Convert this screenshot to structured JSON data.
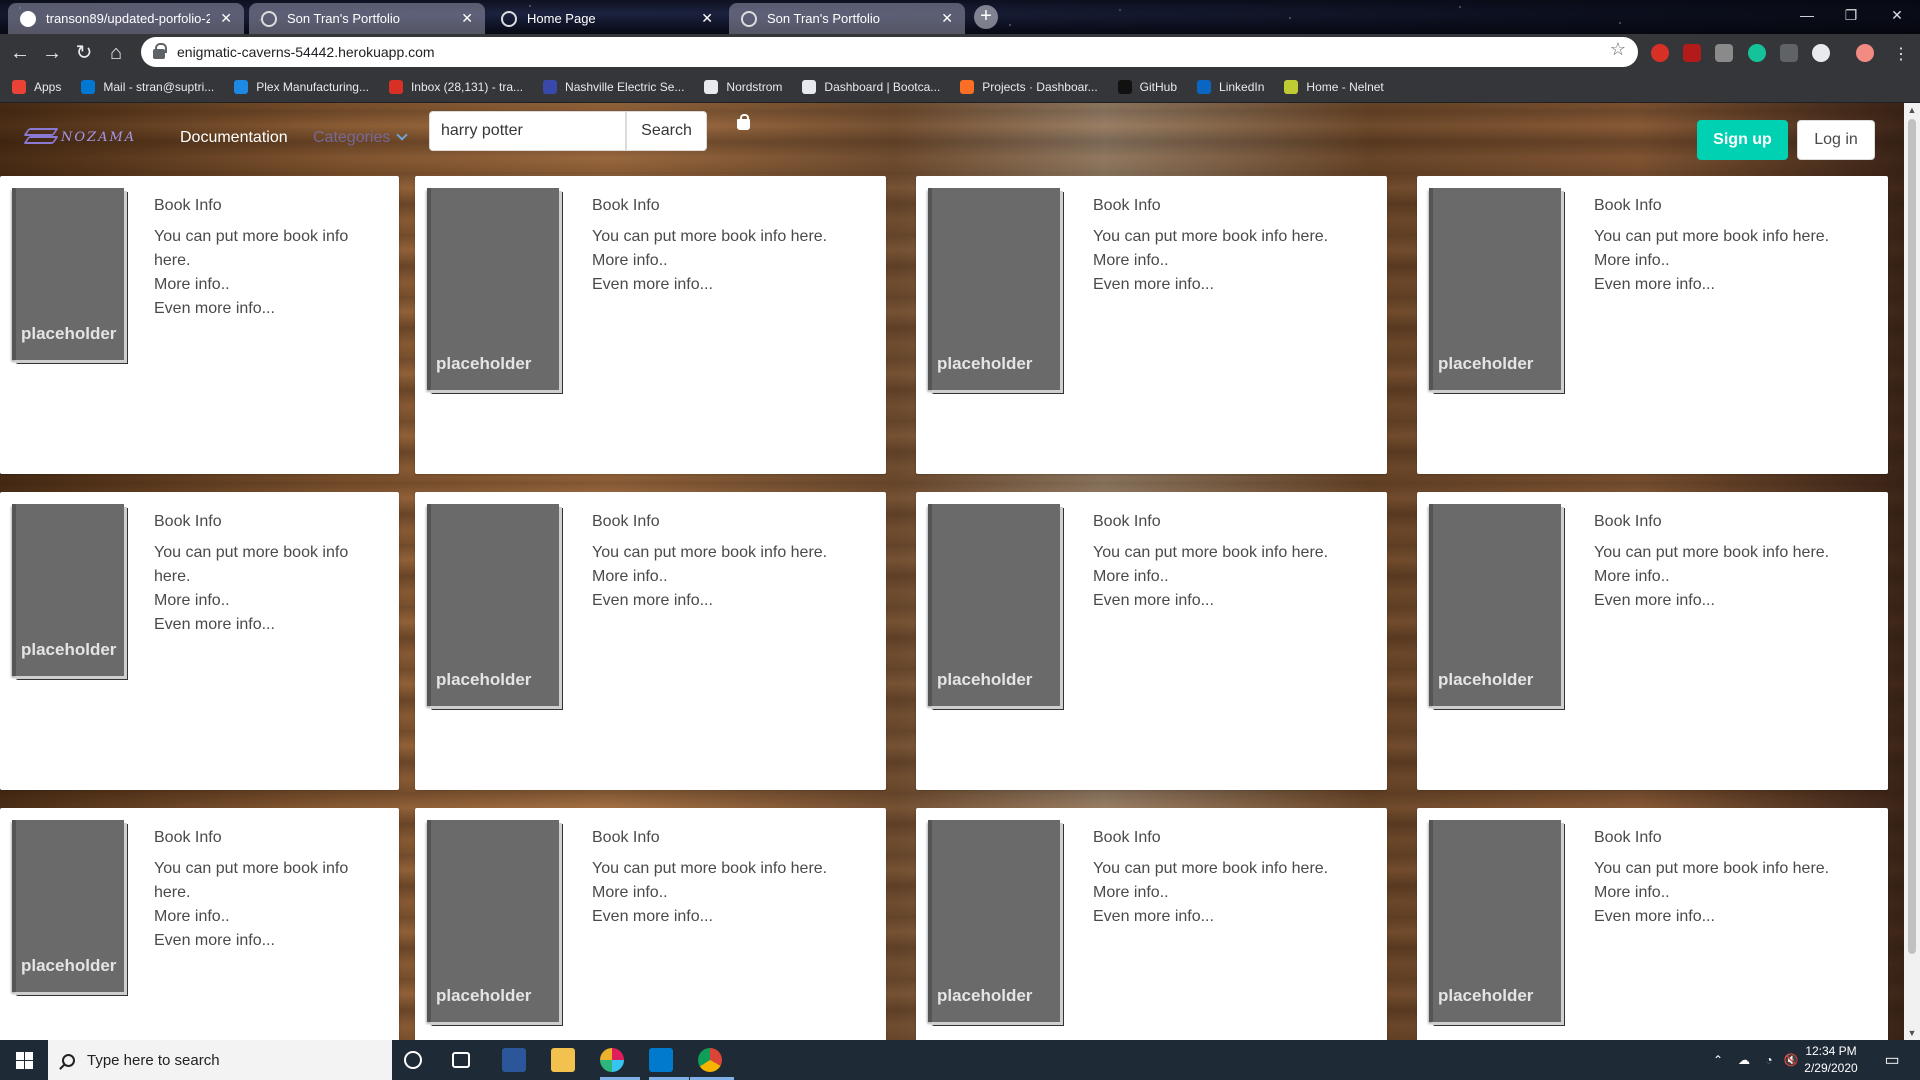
{
  "browser": {
    "tabs": [
      {
        "title": "transon89/updated-porfolio-2"
      },
      {
        "title": "Son Tran's Portfolio"
      },
      {
        "title": "Home Page"
      },
      {
        "title": "Son Tran's Portfolio"
      }
    ],
    "url": "enigmatic-caverns-54442.herokuapp.com",
    "bookmarks": [
      {
        "label": "Apps",
        "color": "#ea4335"
      },
      {
        "label": "Mail - stran@suptri...",
        "color": "#0078d4"
      },
      {
        "label": "Plex Manufacturing...",
        "color": "#1e88e5"
      },
      {
        "label": "Inbox (28,131) - tra...",
        "color": "#d93025"
      },
      {
        "label": "Nashville Electric Se...",
        "color": "#3949ab"
      },
      {
        "label": "Nordstrom",
        "color": "#e8eaed"
      },
      {
        "label": "Dashboard | Bootca...",
        "color": "#e8eaed"
      },
      {
        "label": "Projects · Dashboar...",
        "color": "#fc6d26"
      },
      {
        "label": "GitHub",
        "color": "#111111"
      },
      {
        "label": "LinkedIn",
        "color": "#0a66c2"
      },
      {
        "label": "Home - Nelnet",
        "color": "#c0ca33"
      }
    ]
  },
  "site": {
    "logo_text": "NOZAMA",
    "nav_documentation": "Documentation",
    "nav_categories": "Categories",
    "search_value": "harry potter",
    "search_button": "Search",
    "signup": "Sign up",
    "login": "Log in"
  },
  "cards": [
    {
      "image": "placeholder",
      "title": "Book Info",
      "lines": [
        "You can put more book info",
        "here.",
        "More info..",
        "Even more info..."
      ]
    },
    {
      "image": "placeholder",
      "title": "Book Info",
      "lines": [
        "You can put more book info here.",
        "More info..",
        "Even more info..."
      ]
    },
    {
      "image": "placeholder",
      "title": "Book Info",
      "lines": [
        "You can put more book info here.",
        "More info..",
        "Even more info..."
      ]
    },
    {
      "image": "placeholder",
      "title": "Book Info",
      "lines": [
        "You can put more book info here.",
        "More info..",
        "Even more info..."
      ]
    },
    {
      "image": "placeholder",
      "title": "Book Info",
      "lines": [
        "You can put more book info",
        "here.",
        "More info..",
        "Even more info..."
      ]
    },
    {
      "image": "placeholder",
      "title": "Book Info",
      "lines": [
        "You can put more book info here.",
        "More info..",
        "Even more info..."
      ]
    },
    {
      "image": "placeholder",
      "title": "Book Info",
      "lines": [
        "You can put more book info here.",
        "More info..",
        "Even more info..."
      ]
    },
    {
      "image": "placeholder",
      "title": "Book Info",
      "lines": [
        "You can put more book info here.",
        "More info..",
        "Even more info..."
      ]
    },
    {
      "image": "placeholder",
      "title": "Book Info",
      "lines": [
        "You can put more book info",
        "here.",
        "More info..",
        "Even more info..."
      ]
    },
    {
      "image": "placeholder",
      "title": "Book Info",
      "lines": [
        "You can put more book info here.",
        "More info..",
        "Even more info..."
      ]
    },
    {
      "image": "placeholder",
      "title": "Book Info",
      "lines": [
        "You can put more book info here.",
        "More info..",
        "Even more info..."
      ]
    },
    {
      "image": "placeholder",
      "title": "Book Info",
      "lines": [
        "You can put more book info here.",
        "More info..",
        "Even more info..."
      ]
    }
  ],
  "taskbar": {
    "search_placeholder": "Type here to search",
    "time": "12:34 PM",
    "date": "2/29/2020"
  },
  "colors": {
    "accent": "#00d1b2",
    "logo": "#a597e8",
    "taskbar": "#1f2a37"
  }
}
